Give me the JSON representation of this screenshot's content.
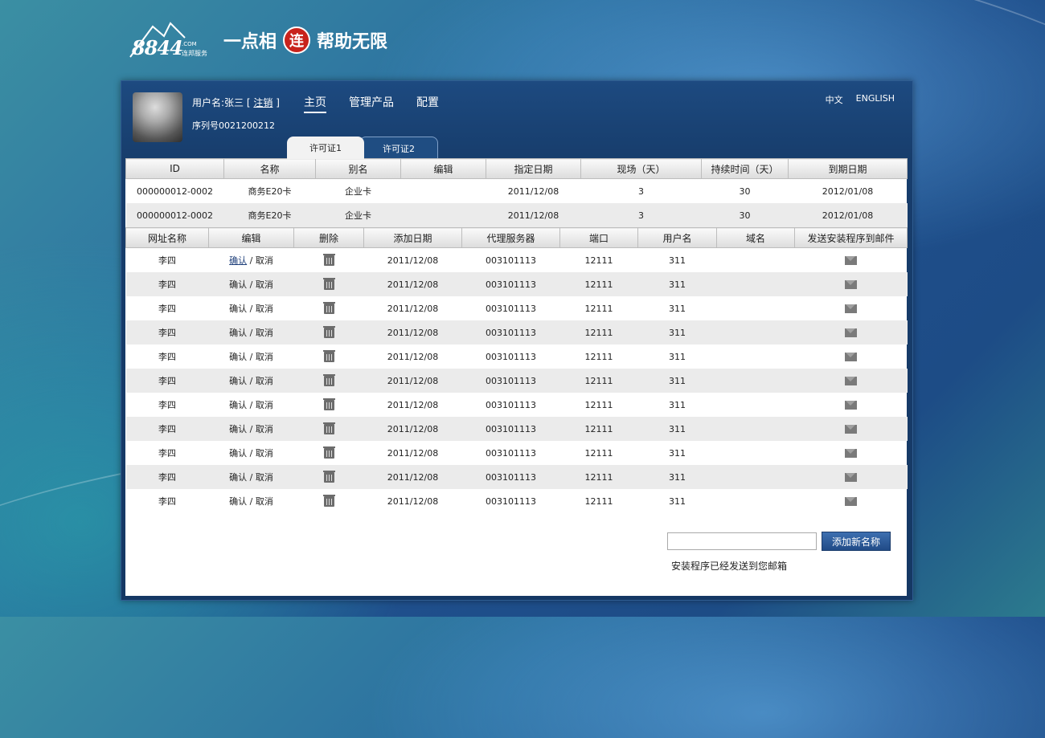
{
  "logo": {
    "digits": "8844",
    "com": ".COM",
    "sub": "连邦服务",
    "slogan1": "一点相",
    "badge": "连",
    "slogan2": "帮助无限"
  },
  "user": {
    "label": "用户名:张三 [",
    "logout": "注销",
    "close_bracket": "]",
    "serial": "序列号0021200212"
  },
  "nav": [
    {
      "label": "主页"
    },
    {
      "label": "管理产品"
    },
    {
      "label": "配置"
    }
  ],
  "lang": [
    "中文",
    "ENGLISH"
  ],
  "tabs": [
    "许可证1",
    "许可证2"
  ],
  "license_table": {
    "headers": [
      "ID",
      "名称",
      "别名",
      "编辑",
      "指定日期",
      "现场（天）",
      "持续时间（天）",
      "到期日期"
    ],
    "rows": [
      [
        "000000012-0002",
        "商务E20卡",
        "企业卡",
        "",
        "2011/12/08",
        "3",
        "30",
        "2012/01/08"
      ],
      [
        "000000012-0002",
        "商务E20卡",
        "企业卡",
        "",
        "2011/12/08",
        "3",
        "30",
        "2012/01/08"
      ]
    ]
  },
  "site_table": {
    "headers": [
      "网址名称",
      "编辑",
      "删除",
      "添加日期",
      "代理服务器",
      "端口",
      "用户名",
      "域名",
      "发送安装程序到邮件"
    ],
    "confirm": "确认",
    "sep": " / ",
    "cancel": "取消",
    "rows": [
      {
        "name": "李四",
        "date": "2011/12/08",
        "proxy": "003101113",
        "port": "12111",
        "user": "311",
        "domain": ""
      },
      {
        "name": "李四",
        "date": "2011/12/08",
        "proxy": "003101113",
        "port": "12111",
        "user": "311",
        "domain": ""
      },
      {
        "name": "李四",
        "date": "2011/12/08",
        "proxy": "003101113",
        "port": "12111",
        "user": "311",
        "domain": ""
      },
      {
        "name": "李四",
        "date": "2011/12/08",
        "proxy": "003101113",
        "port": "12111",
        "user": "311",
        "domain": ""
      },
      {
        "name": "李四",
        "date": "2011/12/08",
        "proxy": "003101113",
        "port": "12111",
        "user": "311",
        "domain": ""
      },
      {
        "name": "李四",
        "date": "2011/12/08",
        "proxy": "003101113",
        "port": "12111",
        "user": "311",
        "domain": ""
      },
      {
        "name": "李四",
        "date": "2011/12/08",
        "proxy": "003101113",
        "port": "12111",
        "user": "311",
        "domain": ""
      },
      {
        "name": "李四",
        "date": "2011/12/08",
        "proxy": "003101113",
        "port": "12111",
        "user": "311",
        "domain": ""
      },
      {
        "name": "李四",
        "date": "2011/12/08",
        "proxy": "003101113",
        "port": "12111",
        "user": "311",
        "domain": ""
      },
      {
        "name": "李四",
        "date": "2011/12/08",
        "proxy": "003101113",
        "port": "12111",
        "user": "311",
        "domain": ""
      },
      {
        "name": "李四",
        "date": "2011/12/08",
        "proxy": "003101113",
        "port": "12111",
        "user": "311",
        "domain": ""
      }
    ]
  },
  "add": {
    "input_value": "",
    "button": "添加新名称",
    "status": "安装程序已经发送到您邮箱"
  },
  "icons": {
    "delete": "trash-icon",
    "mail": "mail-icon"
  }
}
